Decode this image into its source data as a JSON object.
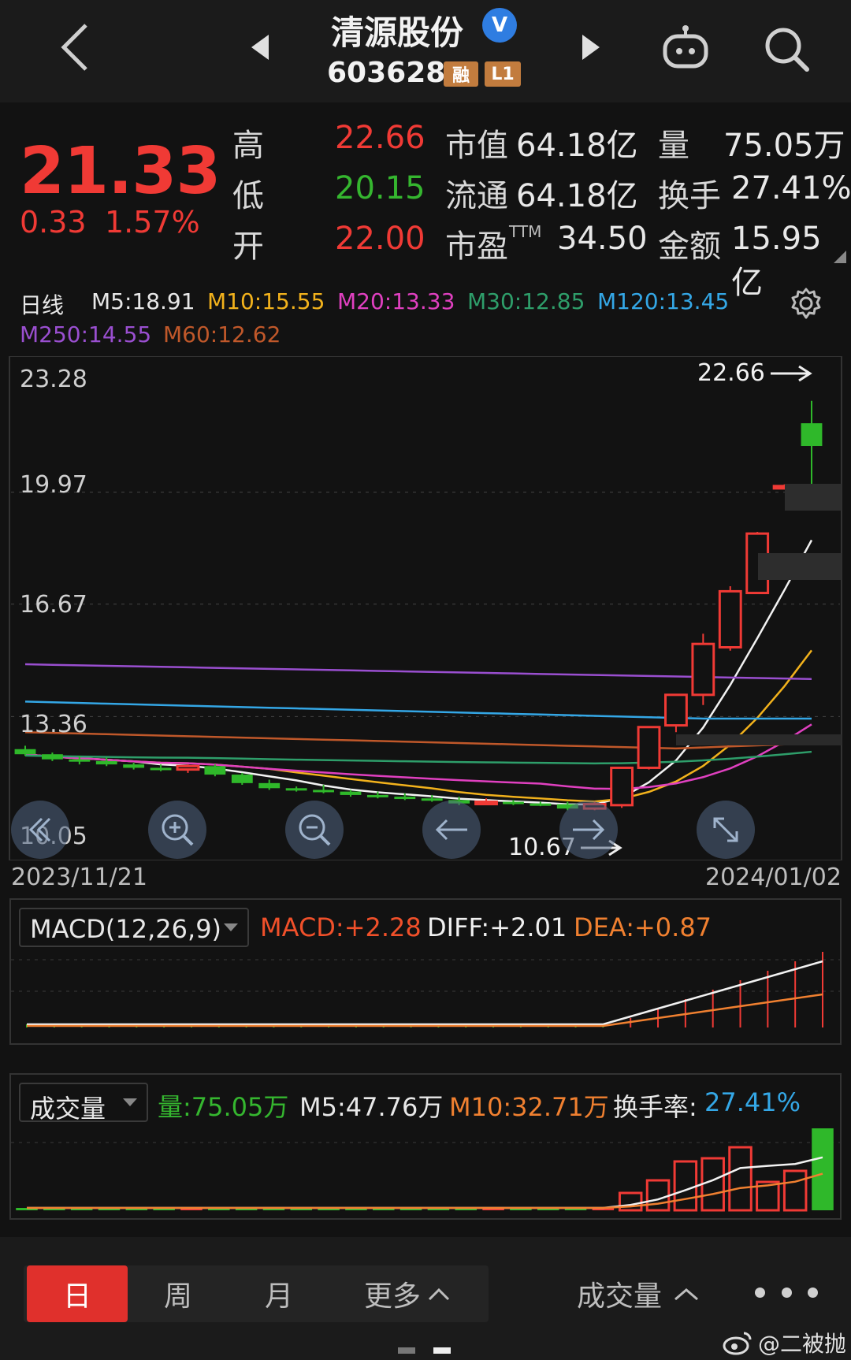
{
  "header": {
    "stock_name": "清源股份",
    "verified_icon": "V",
    "stock_code": "603628",
    "tag_rong": "融",
    "tag_level": "L1"
  },
  "quote": {
    "price": "21.33",
    "change": "0.33",
    "change_pct": "1.57%",
    "high_label": "高",
    "high": "22.66",
    "low_label": "低",
    "low": "20.15",
    "open_label": "开",
    "open": "22.00",
    "mktcap_label": "市值",
    "mktcap": "64.18亿",
    "float_label": "流通",
    "float": "64.18亿",
    "pe_label": "市盈",
    "pe_sup": "TTM",
    "pe": "34.50",
    "vol_label": "量",
    "vol": "75.05万",
    "turnover_label": "换手",
    "turnover": "27.41%",
    "amount_label": "金额",
    "amount": "15.95亿"
  },
  "main_chart": {
    "period_label": "日线",
    "ma": [
      {
        "key": "M5",
        "text": "M5:18.91",
        "color": "#e8e8e8"
      },
      {
        "key": "M10",
        "text": "M10:15.55",
        "color": "#f2b21c"
      },
      {
        "key": "M20",
        "text": "M20:13.33",
        "color": "#e040c0"
      },
      {
        "key": "M30",
        "text": "M30:12.85",
        "color": "#2e9e6a"
      },
      {
        "key": "M120",
        "text": "M120:13.45",
        "color": "#34a7e6"
      },
      {
        "key": "M250",
        "text": "M250:14.55",
        "color": "#9a4fd0"
      },
      {
        "key": "M60",
        "text": "M60:12.62",
        "color": "#c0582a"
      }
    ],
    "y_labels": [
      "23.28",
      "19.97",
      "16.67",
      "13.36",
      "10.05"
    ],
    "max_label": "22.66",
    "min_label": "10.67",
    "date_start": "2023/11/21",
    "date_end": "2024/01/02"
  },
  "macd": {
    "selector": "MACD(12,26,9)",
    "macd": "MACD:+2.28",
    "diff": "DIFF:+2.01",
    "dea": "DEA:+0.87"
  },
  "volume": {
    "selector": "成交量",
    "vol": "量:75.05万",
    "m5": "M5:47.76万",
    "m10": "M10:32.71万",
    "turnover_label": "换手率:",
    "turnover": "27.41%"
  },
  "chart_data": {
    "type": "candlestick",
    "x_range": [
      "2023/11/21",
      "2024/01/02"
    ],
    "y_ticks": [
      23.28,
      19.97,
      16.67,
      13.36,
      10.05
    ],
    "candles": [
      {
        "o": 12.4,
        "h": 12.5,
        "l": 12.2,
        "c": 12.25
      },
      {
        "o": 12.25,
        "h": 12.3,
        "l": 12.05,
        "c": 12.1
      },
      {
        "o": 12.1,
        "h": 12.2,
        "l": 11.95,
        "c": 12.05
      },
      {
        "o": 12.05,
        "h": 12.15,
        "l": 11.9,
        "c": 11.95
      },
      {
        "o": 11.95,
        "h": 12.0,
        "l": 11.8,
        "c": 11.85
      },
      {
        "o": 11.85,
        "h": 11.95,
        "l": 11.75,
        "c": 11.8
      },
      {
        "o": 11.8,
        "h": 11.95,
        "l": 11.7,
        "c": 11.9
      },
      {
        "o": 11.9,
        "h": 11.95,
        "l": 11.6,
        "c": 11.65
      },
      {
        "o": 11.65,
        "h": 11.7,
        "l": 11.35,
        "c": 11.4
      },
      {
        "o": 11.4,
        "h": 11.5,
        "l": 11.2,
        "c": 11.25
      },
      {
        "o": 11.25,
        "h": 11.3,
        "l": 11.15,
        "c": 11.2
      },
      {
        "o": 11.2,
        "h": 11.35,
        "l": 11.1,
        "c": 11.15
      },
      {
        "o": 11.15,
        "h": 11.2,
        "l": 11.0,
        "c": 11.05
      },
      {
        "o": 11.05,
        "h": 11.15,
        "l": 10.95,
        "c": 11.0
      },
      {
        "o": 11.0,
        "h": 11.1,
        "l": 10.9,
        "c": 10.95
      },
      {
        "o": 10.95,
        "h": 11.05,
        "l": 10.85,
        "c": 10.9
      },
      {
        "o": 10.9,
        "h": 11.0,
        "l": 10.75,
        "c": 10.8
      },
      {
        "o": 10.8,
        "h": 10.95,
        "l": 10.75,
        "c": 10.85
      },
      {
        "o": 10.85,
        "h": 10.9,
        "l": 10.75,
        "c": 10.8
      },
      {
        "o": 10.8,
        "h": 10.85,
        "l": 10.72,
        "c": 10.78
      },
      {
        "o": 10.78,
        "h": 10.85,
        "l": 10.6,
        "c": 10.65
      },
      {
        "o": 10.65,
        "h": 10.85,
        "l": 10.6,
        "c": 10.78
      },
      {
        "o": 10.75,
        "h": 11.85,
        "l": 10.67,
        "c": 11.85
      },
      {
        "o": 11.85,
        "h": 13.05,
        "l": 11.8,
        "c": 13.05
      },
      {
        "o": 13.1,
        "h": 14.0,
        "l": 12.9,
        "c": 14.0
      },
      {
        "o": 14.0,
        "h": 15.8,
        "l": 13.7,
        "c": 15.5
      },
      {
        "o": 15.4,
        "h": 17.2,
        "l": 15.3,
        "c": 17.05
      },
      {
        "o": 17.0,
        "h": 18.8,
        "l": 17.0,
        "c": 18.75
      },
      {
        "o": 20.15,
        "h": 20.2,
        "l": 20.1,
        "c": 20.15
      },
      {
        "o": 22.0,
        "h": 22.66,
        "l": 20.15,
        "c": 21.33
      }
    ]
  }
}
